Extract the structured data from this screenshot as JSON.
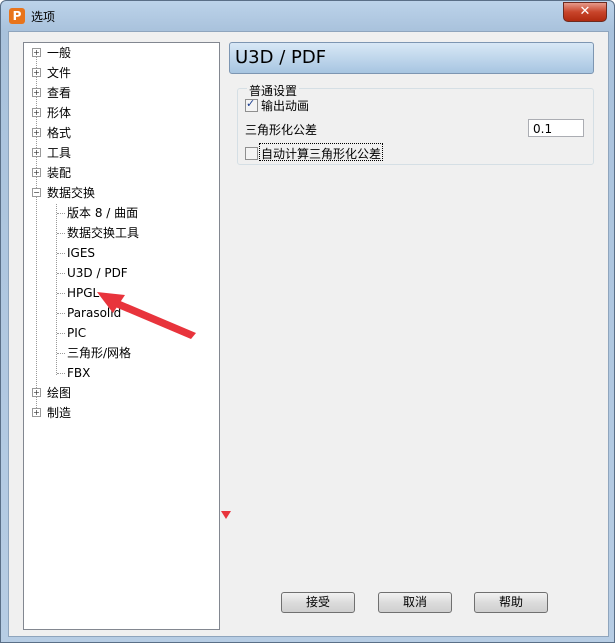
{
  "window": {
    "title": "选项",
    "app_icon": "P"
  },
  "tree": {
    "items": [
      {
        "label": "一般"
      },
      {
        "label": "文件"
      },
      {
        "label": "查看"
      },
      {
        "label": "形体"
      },
      {
        "label": "格式"
      },
      {
        "label": "工具"
      },
      {
        "label": "装配"
      },
      {
        "label": "数据交换"
      },
      {
        "label": "版本 8 / 曲面"
      },
      {
        "label": "数据交换工具"
      },
      {
        "label": "IGES"
      },
      {
        "label": "U3D / PDF"
      },
      {
        "label": "HPGL"
      },
      {
        "label": "Parasolid"
      },
      {
        "label": "PIC"
      },
      {
        "label": "三角形/网格"
      },
      {
        "label": "FBX"
      },
      {
        "label": "绘图"
      },
      {
        "label": "制造"
      }
    ]
  },
  "panel": {
    "header": "U3D / PDF",
    "group_title": "普通设置",
    "export_animation_label": "输出动画",
    "export_animation_checked": true,
    "tolerance_label": "三角形化公差",
    "tolerance_value": "0.1",
    "auto_tolerance_label": "自动计算三角形化公差",
    "auto_tolerance_checked": false
  },
  "buttons": {
    "accept": "接受",
    "cancel": "取消",
    "help": "帮助"
  },
  "colors": {
    "annotation_arrow": "#e8343c"
  }
}
